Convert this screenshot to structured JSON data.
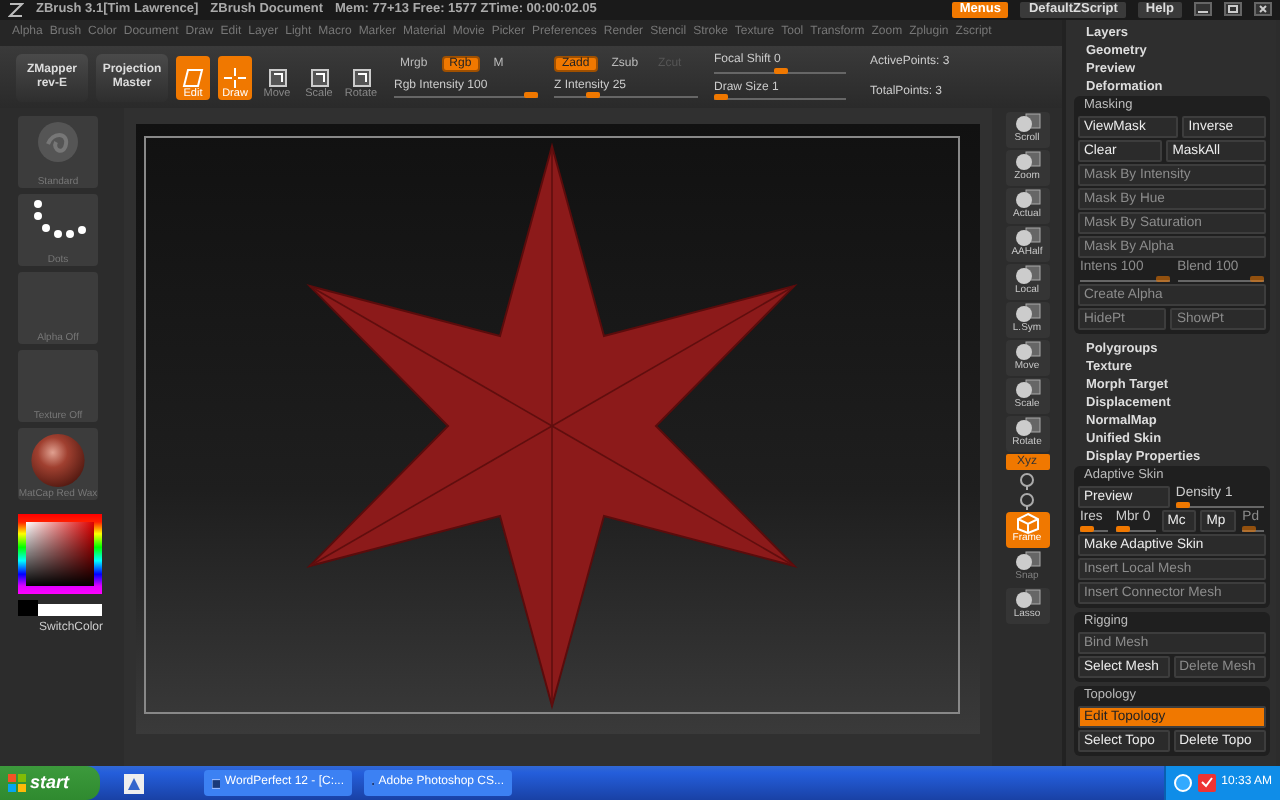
{
  "title_bar": {
    "app": "ZBrush 3.1[Tim Lawrence]",
    "document": "ZBrush Document",
    "stats": "Mem: 77+13 Free: 1577 ZTime: 00:00:02.05",
    "buttons": [
      {
        "label": "Menus",
        "selected": true
      },
      {
        "label": "DefaultZScript",
        "selected": false
      },
      {
        "label": "Help",
        "selected": false
      }
    ]
  },
  "menu_bar": [
    "Alpha",
    "Brush",
    "Color",
    "Document",
    "Draw",
    "Edit",
    "Layer",
    "Light",
    "Macro",
    "Marker",
    "Material",
    "Movie",
    "Picker",
    "Preferences",
    "Render",
    "Stencil",
    "Stroke",
    "Texture",
    "Tool",
    "Transform",
    "Zoom",
    "Zplugin",
    "Zscript"
  ],
  "shelf": {
    "plugins": [
      {
        "label": "ZMapper",
        "sub": "rev-E"
      },
      {
        "label": "Projection",
        "sub": "Master"
      }
    ],
    "tools": [
      {
        "label": "Edit",
        "selected": true
      },
      {
        "label": "Draw",
        "selected": true
      },
      {
        "label": "Move",
        "selected": false
      },
      {
        "label": "Scale",
        "selected": false
      },
      {
        "label": "Rotate",
        "selected": false
      }
    ],
    "color_modes": [
      {
        "label": "Mrgb",
        "selected": false
      },
      {
        "label": "Rgb",
        "selected": true
      },
      {
        "label": "M",
        "selected": false
      }
    ],
    "rgb_intensity": {
      "label": "Rgb Intensity 100",
      "level": 1
    },
    "z_modes": [
      {
        "label": "Zadd",
        "selected": true,
        "disabled": false
      },
      {
        "label": "Zsub",
        "selected": false,
        "disabled": false
      },
      {
        "label": "Zcut",
        "selected": false,
        "disabled": true
      }
    ],
    "z_intensity": {
      "label": "Z Intensity 25",
      "level": 0.25
    },
    "focal_shift": {
      "label": "Focal Shift 0",
      "level": 0.5
    },
    "draw_size": {
      "label": "Draw Size 1",
      "level": 0
    },
    "active_points": "ActivePoints: 3",
    "total_points": "TotalPoints: 3"
  },
  "left_panel": {
    "thumbnails": [
      {
        "kind": "brush",
        "label": "Standard"
      },
      {
        "kind": "stroke",
        "label": "Dots"
      },
      {
        "kind": "empty",
        "label": "Alpha Off"
      },
      {
        "kind": "empty",
        "label": "Texture Off"
      },
      {
        "kind": "material",
        "label": "MatCap Red Wax"
      }
    ],
    "switch_color": "SwitchColor"
  },
  "right_shelf": [
    {
      "kind": "button",
      "label": "Scroll",
      "selected": false,
      "disabled": false
    },
    {
      "kind": "button",
      "label": "Zoom",
      "selected": false,
      "disabled": false
    },
    {
      "kind": "button",
      "label": "Actual",
      "selected": false,
      "disabled": false
    },
    {
      "kind": "button",
      "label": "AAHalf",
      "selected": false,
      "disabled": false
    },
    {
      "kind": "button",
      "label": "Local",
      "selected": false,
      "disabled": false
    },
    {
      "kind": "button",
      "label": "L.Sym",
      "selected": false,
      "disabled": false
    },
    {
      "kind": "button",
      "label": "Move",
      "selected": false,
      "disabled": false
    },
    {
      "kind": "button",
      "label": "Scale",
      "selected": false,
      "disabled": false
    },
    {
      "kind": "button",
      "label": "Rotate",
      "selected": false,
      "disabled": false
    },
    {
      "kind": "toggle",
      "label": "Xyz",
      "selected": true,
      "disabled": false
    },
    {
      "kind": "icon"
    },
    {
      "kind": "icon"
    },
    {
      "kind": "button",
      "label": "Frame",
      "selected": true,
      "disabled": false
    },
    {
      "kind": "button",
      "label": "Snap",
      "selected": false,
      "disabled": true
    },
    {
      "kind": "button",
      "label": "Lasso",
      "selected": false,
      "disabled": false
    }
  ],
  "tool_palette": [
    {
      "kind": "section",
      "label": "Layers"
    },
    {
      "kind": "section",
      "label": "Geometry"
    },
    {
      "kind": "section",
      "label": "Preview"
    },
    {
      "kind": "section",
      "label": "Deformation"
    },
    {
      "kind": "subpanel",
      "title": "Masking",
      "rows": [
        {
          "controls": [
            {
              "kind": "button",
              "label": "ViewMask",
              "selected": false,
              "disabled": false
            },
            {
              "kind": "button",
              "label": "Inverse",
              "selected": false,
              "disabled": false
            }
          ]
        },
        {
          "controls": [
            {
              "kind": "button",
              "label": "Clear",
              "selected": false,
              "disabled": false
            },
            {
              "kind": "button",
              "label": "MaskAll",
              "selected": false,
              "disabled": false
            }
          ]
        },
        {
          "controls": [
            {
              "kind": "button",
              "label": "Mask By Intensity",
              "selected": false,
              "disabled": true
            }
          ]
        },
        {
          "controls": [
            {
              "kind": "button",
              "label": "Mask By Hue",
              "selected": false,
              "disabled": true
            }
          ]
        },
        {
          "controls": [
            {
              "kind": "button",
              "label": "Mask By Saturation",
              "selected": false,
              "disabled": true
            }
          ]
        },
        {
          "controls": [
            {
              "kind": "button",
              "label": "Mask By Alpha",
              "selected": false,
              "disabled": true
            }
          ]
        },
        {
          "controls": [
            {
              "kind": "slider",
              "label": "Intens 100",
              "level": 1,
              "disabled": true
            },
            {
              "kind": "slider",
              "label": "Blend 100",
              "level": 1,
              "disabled": true
            }
          ]
        },
        {
          "controls": [
            {
              "kind": "button",
              "label": "Create Alpha",
              "selected": false,
              "disabled": true
            }
          ]
        },
        {
          "controls": [
            {
              "kind": "button",
              "label": "HidePt",
              "selected": false,
              "disabled": true
            },
            {
              "kind": "button",
              "label": "ShowPt",
              "selected": false,
              "disabled": true
            }
          ]
        }
      ]
    },
    {
      "kind": "section",
      "label": "Polygroups"
    },
    {
      "kind": "section",
      "label": "Texture"
    },
    {
      "kind": "section",
      "label": "Morph Target"
    },
    {
      "kind": "section",
      "label": "Displacement"
    },
    {
      "kind": "section",
      "label": "NormalMap"
    },
    {
      "kind": "section",
      "label": "Unified Skin"
    },
    {
      "kind": "section",
      "label": "Display Properties"
    },
    {
      "kind": "subpanel",
      "title": "Adaptive Skin",
      "rows": [
        {
          "controls": [
            {
              "kind": "button",
              "label": "Preview",
              "selected": false,
              "disabled": false
            },
            {
              "kind": "slider",
              "label": "Density 1",
              "level": 0,
              "disabled": false
            }
          ]
        },
        {
          "controls": [
            {
              "kind": "slider",
              "label": "Ires",
              "level": 0,
              "disabled": false
            },
            {
              "kind": "slider",
              "label": "Mbr 0",
              "level": 0,
              "disabled": false
            },
            {
              "kind": "button",
              "label": "Mc",
              "selected": false,
              "disabled": false
            },
            {
              "kind": "button",
              "label": "Mp",
              "selected": false,
              "disabled": false
            },
            {
              "kind": "slider",
              "label": "Pd",
              "level": 0,
              "disabled": true
            }
          ]
        },
        {
          "controls": [
            {
              "kind": "button",
              "label": "Make Adaptive Skin",
              "selected": false,
              "disabled": false
            }
          ]
        },
        {
          "controls": [
            {
              "kind": "button",
              "label": "Insert Local Mesh",
              "selected": false,
              "disabled": true
            }
          ]
        },
        {
          "controls": [
            {
              "kind": "button",
              "label": "Insert Connector Mesh",
              "selected": false,
              "disabled": true
            }
          ]
        }
      ]
    },
    {
      "kind": "subpanel",
      "title": "Rigging",
      "rows": [
        {
          "controls": [
            {
              "kind": "button",
              "label": "Bind Mesh",
              "selected": false,
              "disabled": true
            }
          ]
        },
        {
          "controls": [
            {
              "kind": "button",
              "label": "Select Mesh",
              "selected": false,
              "disabled": false
            },
            {
              "kind": "button",
              "label": "Delete Mesh",
              "selected": false,
              "disabled": true
            }
          ]
        }
      ]
    },
    {
      "kind": "subpanel",
      "title": "Topology",
      "rows": [
        {
          "controls": [
            {
              "kind": "button",
              "label": "Edit Topology",
              "selected": true,
              "disabled": false
            }
          ]
        },
        {
          "controls": [
            {
              "kind": "button",
              "label": "Select Topo",
              "selected": false,
              "disabled": false
            },
            {
              "kind": "button",
              "label": "Delete Topo",
              "selected": false,
              "disabled": false
            }
          ]
        }
      ]
    }
  ],
  "taskbar": {
    "start": "start",
    "tasks": [
      {
        "label": "WordPerfect 12 - [C:...",
        "selected": false
      },
      {
        "label": "Adobe Photoshop CS...",
        "selected": false
      }
    ],
    "clock": "10:33 AM"
  }
}
